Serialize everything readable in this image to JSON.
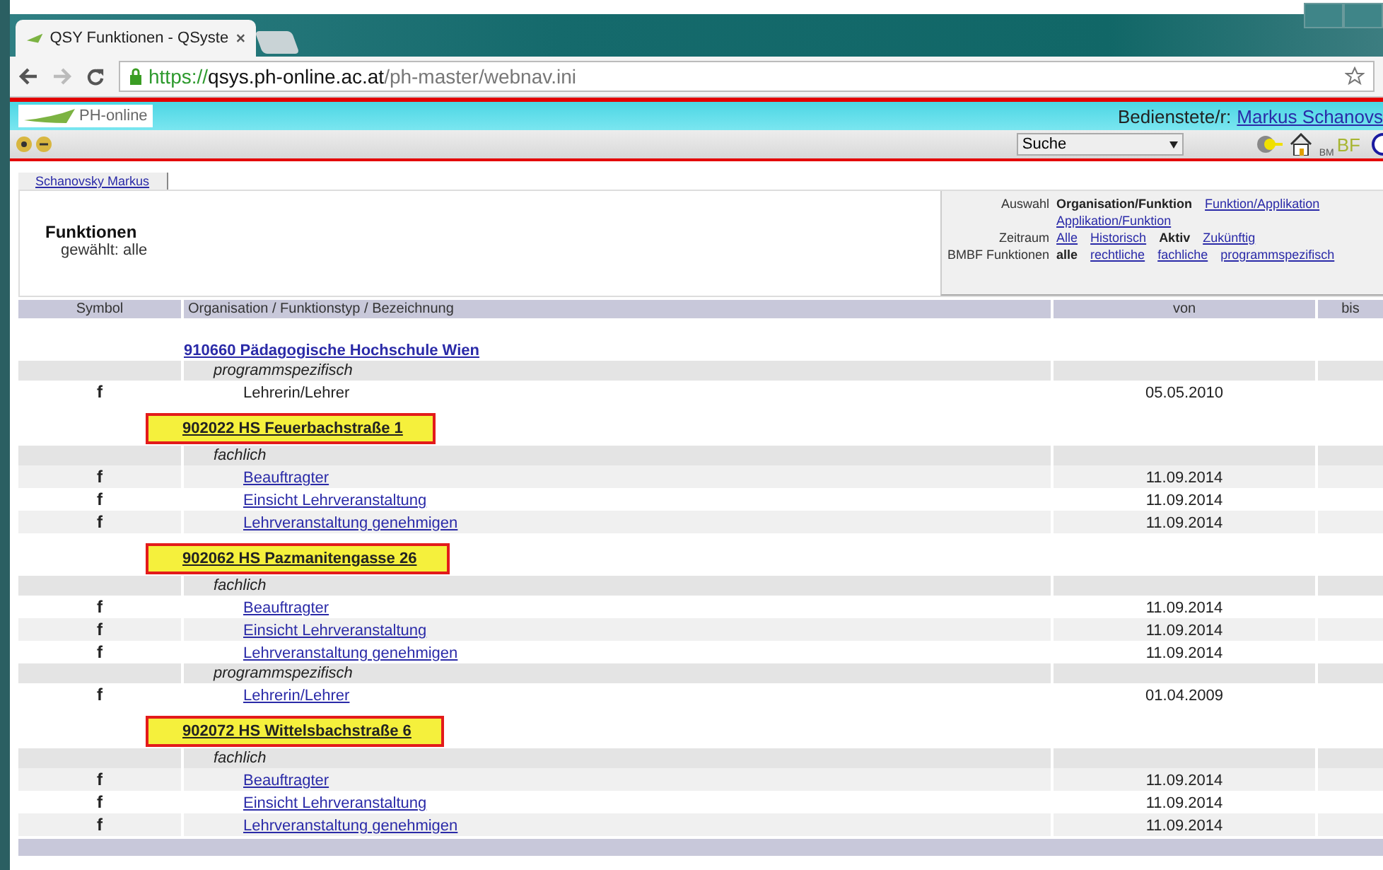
{
  "browser": {
    "tab_title": "QSY Funktionen - QSyste",
    "url": {
      "scheme": "https://",
      "host": "qsys.ph-online.ac.at",
      "path": "/ph-master/webnav.ini"
    }
  },
  "app_header": {
    "logo_text": "PH-online",
    "user_label": "Bedienstete/r:",
    "user_name": "Markus Schanovs"
  },
  "toolbar": {
    "search_select": "Suche",
    "bm_label": "BM",
    "bf_label": "BF"
  },
  "person_tab": "Schanovsky Markus",
  "heading": {
    "title": "Funktionen",
    "subtitle": "gewählt: alle"
  },
  "filters": [
    {
      "label": "Auswahl",
      "options": [
        {
          "text": "Organisation/Funktion",
          "selected": true
        },
        {
          "text": "Funktion/Applikation",
          "selected": false
        },
        {
          "text": "Applikation/Funktion",
          "selected": false
        }
      ]
    },
    {
      "label": "Zeitraum",
      "options": [
        {
          "text": "Alle",
          "selected": false
        },
        {
          "text": "Historisch",
          "selected": false
        },
        {
          "text": "Aktiv",
          "selected": true
        },
        {
          "text": "Zukünftig",
          "selected": false
        }
      ]
    },
    {
      "label": "BMBF Funktionen",
      "options": [
        {
          "text": "alle",
          "selected": true
        },
        {
          "text": "rechtliche",
          "selected": false
        },
        {
          "text": "fachliche",
          "selected": false
        },
        {
          "text": "programmspezifisch",
          "selected": false
        }
      ]
    }
  ],
  "table": {
    "columns": [
      "Symbol",
      "Organisation / Funktionstyp / Bezeichnung",
      "von",
      "bis"
    ],
    "rows": [
      {
        "kind": "org",
        "label": "910660 Pädagogische Hochschule Wien",
        "highlighted": false
      },
      {
        "kind": "type",
        "label": "programmspezifisch"
      },
      {
        "kind": "function",
        "symbol": "f",
        "label": "Lehrerin/Lehrer",
        "linked": false,
        "von": "05.05.2010"
      },
      {
        "kind": "org",
        "label": "902022 HS Feuerbachstraße 1",
        "highlighted": true
      },
      {
        "kind": "type",
        "label": "fachlich"
      },
      {
        "kind": "function",
        "symbol": "f",
        "label": "Beauftragter",
        "linked": true,
        "von": "11.09.2014"
      },
      {
        "kind": "function",
        "symbol": "f",
        "label": "Einsicht Lehrveranstaltung",
        "linked": true,
        "von": "11.09.2014"
      },
      {
        "kind": "function",
        "symbol": "f",
        "label": "Lehrveranstaltung genehmigen",
        "linked": true,
        "von": "11.09.2014"
      },
      {
        "kind": "org",
        "label": "902062 HS Pazmanitengasse 26",
        "highlighted": true
      },
      {
        "kind": "type",
        "label": "fachlich"
      },
      {
        "kind": "function",
        "symbol": "f",
        "label": "Beauftragter",
        "linked": true,
        "von": "11.09.2014"
      },
      {
        "kind": "function",
        "symbol": "f",
        "label": "Einsicht Lehrveranstaltung",
        "linked": true,
        "von": "11.09.2014"
      },
      {
        "kind": "function",
        "symbol": "f",
        "label": "Lehrveranstaltung genehmigen",
        "linked": true,
        "von": "11.09.2014"
      },
      {
        "kind": "type",
        "label": "programmspezifisch"
      },
      {
        "kind": "function",
        "symbol": "f",
        "label": "Lehrerin/Lehrer",
        "linked": true,
        "von": "01.04.2009"
      },
      {
        "kind": "org",
        "label": "902072 HS Wittelsbachstraße 6",
        "highlighted": true
      },
      {
        "kind": "type",
        "label": "fachlich"
      },
      {
        "kind": "function",
        "symbol": "f",
        "label": "Beauftragter",
        "linked": true,
        "von": "11.09.2014"
      },
      {
        "kind": "function",
        "symbol": "f",
        "label": "Einsicht Lehrveranstaltung",
        "linked": true,
        "von": "11.09.2014"
      },
      {
        "kind": "function",
        "symbol": "f",
        "label": "Lehrveranstaltung genehmigen",
        "linked": true,
        "von": "11.09.2014"
      }
    ]
  }
}
